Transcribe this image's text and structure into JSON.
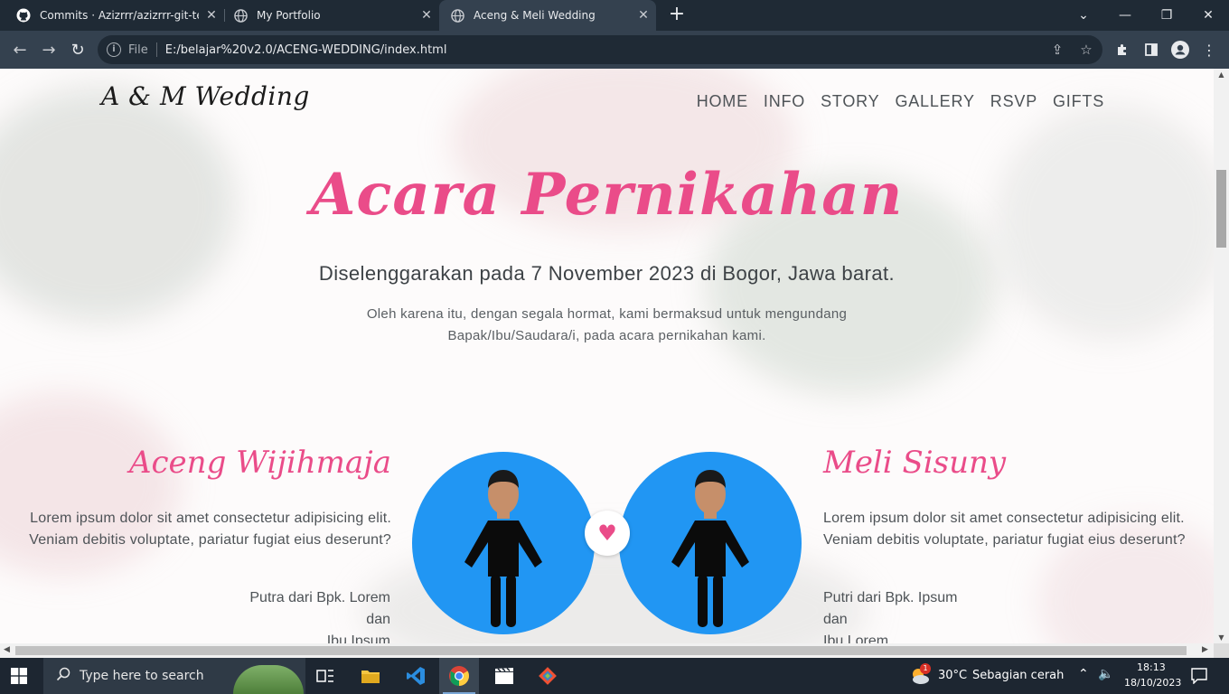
{
  "browser": {
    "tabs": [
      {
        "title": "Commits · Azizrrr/azizrrr-git-test",
        "icon": "github-icon"
      },
      {
        "title": "My Portfolio",
        "icon": "globe-icon"
      },
      {
        "title": "Aceng & Meli Wedding",
        "icon": "globe-icon",
        "active": true
      }
    ],
    "address": {
      "scheme_label": "File",
      "url": "E:/belajar%20v2.0/ACENG-WEDDING/index.html"
    }
  },
  "page": {
    "brand": "A & M Wedding",
    "nav": [
      "HOME",
      "INFO",
      "STORY",
      "GALLERY",
      "RSVP",
      "GIFTS"
    ],
    "hero": {
      "title": "Acara Pernikahan",
      "subtitle": "Diselenggarakan pada 7 November 2023 di Bogor, Jawa barat.",
      "description": "Oleh karena itu, dengan segala hormat, kami bermaksud untuk mengundang Bapak/Ibu/Saudara/i, pada acara pernikahan kami."
    },
    "groom": {
      "name": "Aceng Wijihmaja",
      "text": "Lorem ipsum dolor sit amet consectetur adipisicing elit. Veniam debitis voluptate, pariatur fugiat eius deserunt?",
      "parents_line1": "Putra dari Bpk. Lorem",
      "parents_line2": "dan",
      "parents_line3": "Ibu Ipsum"
    },
    "bride": {
      "name": "Meli Sisuny",
      "text": "Lorem ipsum dolor sit amet consectetur adipisicing elit. Veniam debitis voluptate, pariatur fugiat eius deserunt?",
      "parents_line1": "Putri dari Bpk. Ipsum",
      "parents_line2": "dan",
      "parents_line3": "Ibu Lorem"
    },
    "colors": {
      "accent": "#ea4c89",
      "photo_bg": "#2196f3"
    }
  },
  "taskbar": {
    "search_placeholder": "Type here to search",
    "weather_temp": "30°C",
    "weather_text": "Sebagian cerah",
    "weather_badge": "1",
    "time": "18:13",
    "date": "18/10/2023"
  }
}
